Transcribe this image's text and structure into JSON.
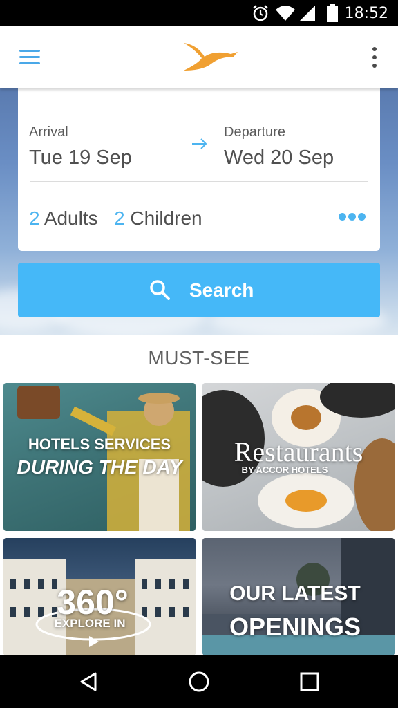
{
  "status_bar": {
    "time": "18:52",
    "icons": [
      "alarm-icon",
      "wifi-icon",
      "signal-icon",
      "battery-icon"
    ]
  },
  "app_bar": {
    "menu_icon": "hamburger-menu-icon",
    "logo": "accor-bird-logo",
    "overflow_icon": "more-vertical-icon"
  },
  "booking": {
    "arrival_label": "Arrival",
    "arrival_date": "Tue 19 Sep",
    "departure_label": "Departure",
    "departure_date": "Wed 20 Sep",
    "adults_count": "2",
    "adults_label": "Adults",
    "children_count": "2",
    "children_label": "Children"
  },
  "search": {
    "label": "Search",
    "icon": "search-icon"
  },
  "must_see": {
    "title": "MUST-SEE",
    "tiles": [
      {
        "line1": "HOTELS SERVICES",
        "line2": "DURING THE DAY"
      },
      {
        "line1": "Restaurants",
        "line2": "BY ACCOR HOTELS"
      },
      {
        "line1": "360°",
        "line2": "EXPLORE IN"
      },
      {
        "line1": "OUR LATEST",
        "line2": "OPENINGS"
      }
    ]
  },
  "colors": {
    "accent": "#45b8f8",
    "accent_text": "#4cb4f0",
    "logo": "#f0a032"
  },
  "nav_bar": {
    "icons": [
      "back-icon",
      "home-icon",
      "recents-icon"
    ]
  }
}
